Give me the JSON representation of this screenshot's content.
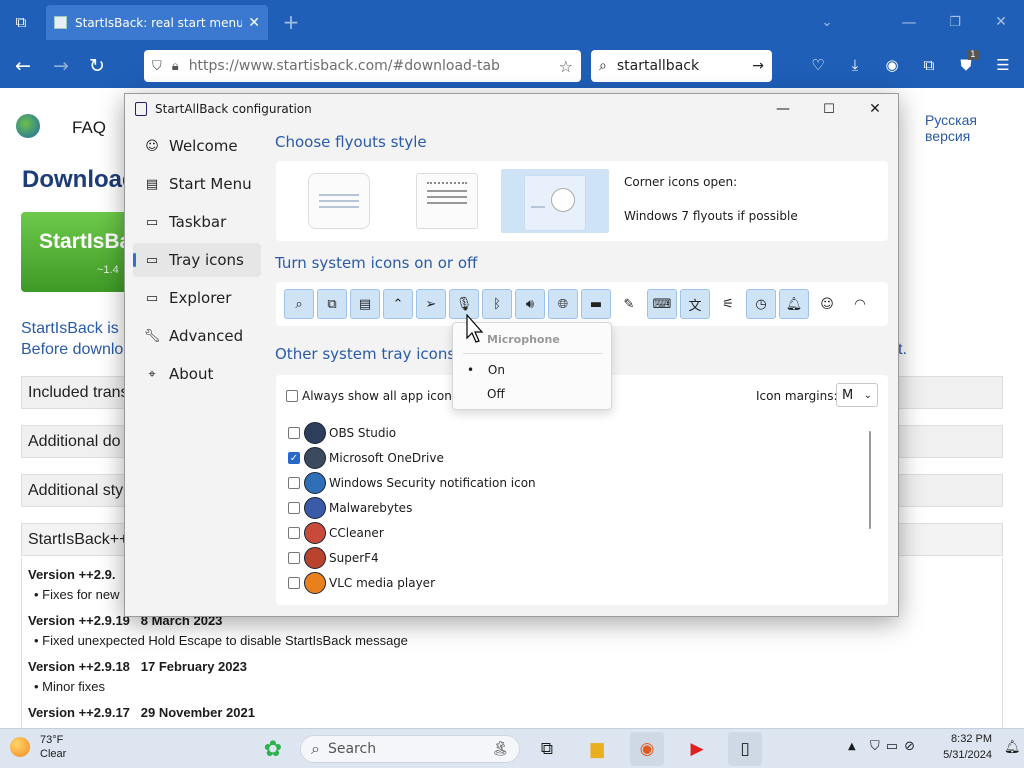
{
  "browser": {
    "tab_title": "StartIsBack: real start menu for",
    "url": "https://www.startisback.com/#download-tab",
    "search_query": "startallback",
    "notification_count": "1"
  },
  "site": {
    "nav_faq": "FAQ",
    "lang_link": "Русская версия",
    "heading": "Download",
    "download_btn_title": "StartIsBack",
    "download_btn_sub": "~1.4",
    "para_line1": "StartIsBack is d",
    "para_line2": "Before downlo",
    "para_end": "t.",
    "acc1": "Included trans",
    "acc2": "Additional do",
    "acc3": "Additional sty",
    "acc4": "StartIsBack++",
    "versions": [
      {
        "title": "Version ++2.9.",
        "note": "Fixes for new"
      },
      {
        "title": "Version ++2.9.19   8 March 2023",
        "note": "Fixed unexpected Hold Escape to disable StartIsBack message"
      },
      {
        "title": "Version ++2.9.18   17 February 2023",
        "note": "Minor fixes"
      },
      {
        "title": "Version ++2.9.17   29 November 2021",
        "note": ""
      }
    ]
  },
  "dialog": {
    "title": "StartAllBack configuration",
    "sidebar": [
      {
        "label": "Welcome",
        "icon": "☺"
      },
      {
        "label": "Start Menu",
        "icon": "▤"
      },
      {
        "label": "Taskbar",
        "icon": "▭"
      },
      {
        "label": "Tray icons",
        "icon": "▭"
      },
      {
        "label": "Explorer",
        "icon": "▭"
      },
      {
        "label": "Advanced",
        "icon": "🔧"
      },
      {
        "label": "About",
        "icon": "⌖"
      }
    ],
    "selected_sidebar": "Tray icons",
    "flyouts_title": "Choose flyouts style",
    "corner_label": "Corner icons open:",
    "corner_value": "Windows 7 flyouts if possible",
    "system_icons_title": "Turn system icons on or off",
    "other_title": "Other system tray icons",
    "always_show": "Always show all app icons",
    "icon_margins_label": "Icon margins:",
    "icon_margins_value": "M",
    "popup": {
      "header": "Microphone",
      "on": "On",
      "off": "Off"
    },
    "apps": [
      {
        "name": "OBS Studio",
        "checked": false
      },
      {
        "name": "Microsoft OneDrive",
        "checked": true
      },
      {
        "name": "Windows Security notification icon",
        "checked": false
      },
      {
        "name": "Malwarebytes",
        "checked": false
      },
      {
        "name": "CCleaner",
        "checked": false
      },
      {
        "name": "SuperF4",
        "checked": false
      },
      {
        "name": "VLC media player",
        "checked": false
      }
    ]
  },
  "taskbar": {
    "temp": "73°F",
    "weather": "Clear",
    "search": "Search",
    "time": "8:32 PM",
    "date": "5/31/2024"
  }
}
